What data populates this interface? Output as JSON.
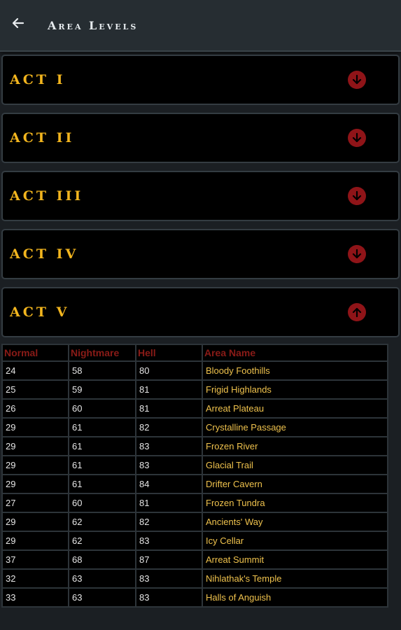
{
  "header": {
    "back_icon": "back-arrow-icon",
    "title": "Area Levels"
  },
  "acts": [
    {
      "label": "ACT I",
      "icon": "arrow-down-circle-icon",
      "expanded": false
    },
    {
      "label": "ACT II",
      "icon": "arrow-down-circle-icon",
      "expanded": false
    },
    {
      "label": "ACT III",
      "icon": "arrow-down-circle-icon",
      "expanded": false
    },
    {
      "label": "ACT IV",
      "icon": "arrow-down-circle-icon",
      "expanded": false
    },
    {
      "label": "ACT V",
      "icon": "arrow-up-circle-icon",
      "expanded": true
    }
  ],
  "table": {
    "headers": {
      "normal": "Normal",
      "nightmare": "Nightmare",
      "hell": "Hell",
      "area": "Area Name"
    },
    "rows": [
      {
        "normal": "24",
        "nightmare": "58",
        "hell": "80",
        "area": "Bloody Foothills"
      },
      {
        "normal": "25",
        "nightmare": "59",
        "hell": "81",
        "area": "Frigid Highlands"
      },
      {
        "normal": "26",
        "nightmare": "60",
        "hell": "81",
        "area": "Arreat Plateau"
      },
      {
        "normal": "29",
        "nightmare": "61",
        "hell": "82",
        "area": "Crystalline Passage"
      },
      {
        "normal": "29",
        "nightmare": "61",
        "hell": "83",
        "area": "Frozen River"
      },
      {
        "normal": "29",
        "nightmare": "61",
        "hell": "83",
        "area": "Glacial Trail"
      },
      {
        "normal": "29",
        "nightmare": "61",
        "hell": "84",
        "area": "Drifter Cavern"
      },
      {
        "normal": "27",
        "nightmare": "60",
        "hell": "81",
        "area": "Frozen Tundra"
      },
      {
        "normal": "29",
        "nightmare": "62",
        "hell": "82",
        "area": "Ancients' Way"
      },
      {
        "normal": "29",
        "nightmare": "62",
        "hell": "83",
        "area": "Icy Cellar"
      },
      {
        "normal": "37",
        "nightmare": "68",
        "hell": "87",
        "area": "Arreat Summit"
      },
      {
        "normal": "32",
        "nightmare": "63",
        "hell": "83",
        "area": "Nihlathak's Temple"
      },
      {
        "normal": "33",
        "nightmare": "63",
        "hell": "83",
        "area": "Halls of Anguish"
      }
    ]
  },
  "colors": {
    "act_label": "#f2b51e",
    "icon_fill": "#8f1418",
    "header_text": "#8a1b17",
    "area_text": "#efc24d"
  }
}
